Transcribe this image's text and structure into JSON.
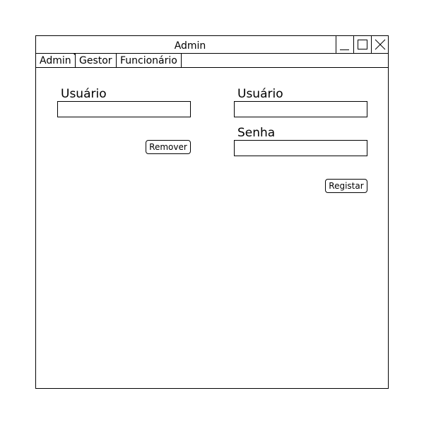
{
  "window": {
    "title": "Admin"
  },
  "tabs": [
    {
      "label": "Admin",
      "active": true
    },
    {
      "label": "Gestor",
      "active": false
    },
    {
      "label": "Funcionário",
      "active": false
    }
  ],
  "remove_panel": {
    "user_label": "Usuário",
    "user_value": "",
    "remove_label": "Remover"
  },
  "register_panel": {
    "user_label": "Usuário",
    "user_value": "",
    "password_label": "Senha",
    "password_value": "",
    "register_label": "Registar"
  },
  "icons": {
    "minimize": "minimize-icon",
    "maximize": "maximize-icon",
    "close": "close-icon"
  }
}
